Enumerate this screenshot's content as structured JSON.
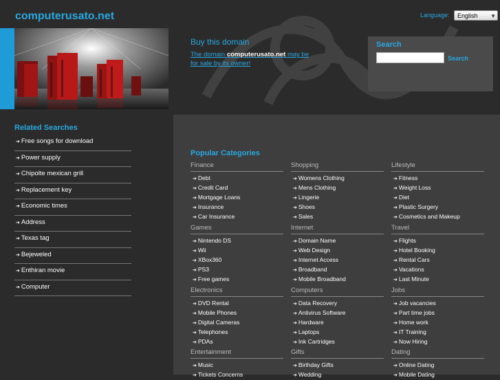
{
  "header": {
    "site_title": "computerusato.net",
    "language_label": "Language:",
    "language_value": "English"
  },
  "hero": {
    "buy_title": "Buy this domain",
    "buy_text_prefix": "The domain ",
    "buy_text_domain": "computerusato.net",
    "buy_text_suffix": " may be for sale by its owner!"
  },
  "search": {
    "title": "Search",
    "button_label": "Search",
    "input_value": ""
  },
  "related": {
    "title": "Related Searches",
    "items": [
      "Free songs for download",
      "Power supply",
      "Chipolte mexican grill",
      "Replacement key",
      "Economic times",
      "Address",
      "Texas tag",
      "Bejeweled",
      "Enthiran movie",
      "Computer"
    ]
  },
  "popular": {
    "title": "Popular Categories",
    "categories": [
      {
        "name": "Finance",
        "links": [
          "Debt",
          "Credit Card",
          "Mortgage Loans",
          "Insurance",
          "Car Insurance"
        ]
      },
      {
        "name": "Shopping",
        "links": [
          "Womens Clothing",
          "Mens Clothing",
          "Lingerie",
          "Shoes",
          "Sales"
        ]
      },
      {
        "name": "Lifestyle",
        "links": [
          "Fitness",
          "Weight Loss",
          "Diet",
          "Plastic Surgery",
          "Cosmetics and Makeup"
        ]
      },
      {
        "name": "Games",
        "links": [
          "Nintendo DS",
          "Wii",
          "XBox360",
          "PS3",
          "Free games"
        ]
      },
      {
        "name": "Internet",
        "links": [
          "Domain Name",
          "Web Design",
          "Internet Access",
          "Broadband",
          "Mobile Broadband"
        ]
      },
      {
        "name": "Travel",
        "links": [
          "Flights",
          "Hotel Booking",
          "Rental Cars",
          "Vacations",
          "Last Minute"
        ]
      },
      {
        "name": "Electronics",
        "links": [
          "DVD Rental",
          "Mobile Phones",
          "Digital Cameras",
          "Telephones",
          "PDAs"
        ]
      },
      {
        "name": "Computers",
        "links": [
          "Data Recovery",
          "Antivirus Software",
          "Hardware",
          "Laptops",
          "Ink Cartridges"
        ]
      },
      {
        "name": "Jobs",
        "links": [
          "Job vacancies",
          "Part time jobs",
          "Home work",
          "IT Training",
          "Now Hiring"
        ]
      },
      {
        "name": "Entertainment",
        "links": [
          "Music",
          "Tickets Concerns"
        ]
      },
      {
        "name": "Gifts",
        "links": [
          "Birthday Gifts",
          "Wedding"
        ]
      },
      {
        "name": "Dating",
        "links": [
          "Online Dating",
          "Mobile Dating"
        ]
      }
    ]
  },
  "colors": {
    "accent": "#29a8e0",
    "background": "#2b2b2b",
    "panel": "#3e3e3e"
  }
}
